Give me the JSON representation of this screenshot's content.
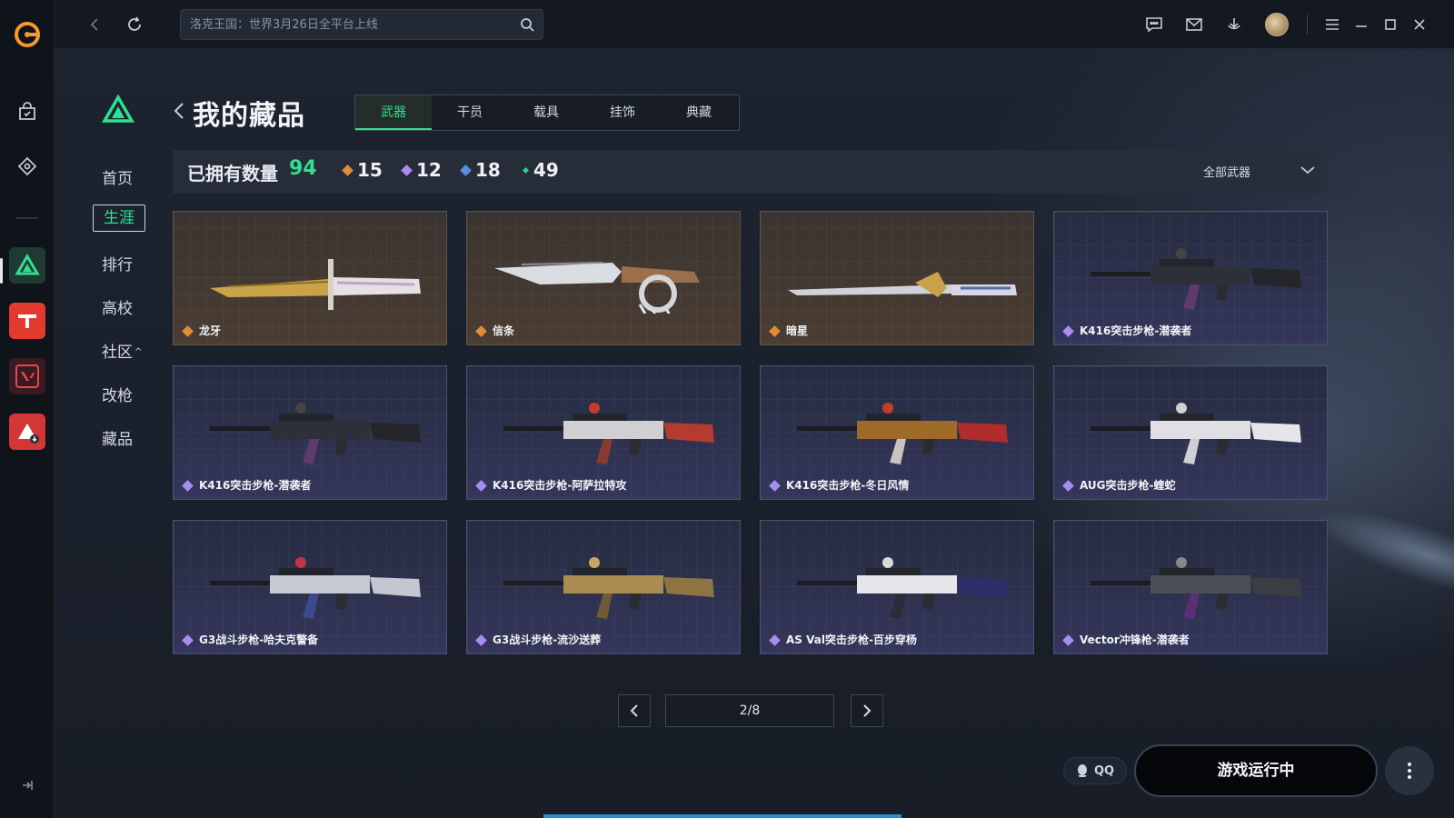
{
  "topbar": {
    "search_placeholder": "洛克王国：世界3月26日全平台上线"
  },
  "subnav": {
    "items": [
      {
        "label": "首页"
      },
      {
        "label": "生涯",
        "active": true
      },
      {
        "label": "排行"
      },
      {
        "label": "高校"
      },
      {
        "label": "社区"
      },
      {
        "label": "改枪"
      },
      {
        "label": "藏品"
      }
    ]
  },
  "header": {
    "title": "我的藏品",
    "tabs": [
      {
        "label": "武器",
        "active": true
      },
      {
        "label": "干员"
      },
      {
        "label": "载具"
      },
      {
        "label": "挂饰"
      },
      {
        "label": "典藏"
      }
    ]
  },
  "stats": {
    "owned_label": "已拥有数量",
    "owned_count": "94",
    "tiers": [
      {
        "value": "15",
        "color": "#e28a3a"
      },
      {
        "value": "12",
        "color": "#a98cf0"
      },
      {
        "value": "18",
        "color": "#5a8fe0"
      },
      {
        "value": "49",
        "color": "#2ecf8a"
      }
    ],
    "filter_label": "全部武器"
  },
  "colors": {
    "accent": "#2ee08f",
    "rarity_gold": "#e28a3a",
    "rarity_purple": "#a98cf0"
  },
  "items": [
    {
      "name": "龙牙",
      "rarity": "gold",
      "icon": "knife-icon"
    },
    {
      "name": "信条",
      "rarity": "gold",
      "icon": "knife-icon"
    },
    {
      "name": "暗星",
      "rarity": "gold",
      "icon": "knife-icon"
    },
    {
      "name": "K416突击步枪-潜袭者",
      "rarity": "purple",
      "icon": "rifle-icon"
    },
    {
      "name": "K416突击步枪-潜袭者",
      "rarity": "purple",
      "icon": "rifle-icon"
    },
    {
      "name": "K416突击步枪-阿萨拉特攻",
      "rarity": "purple",
      "icon": "rifle-icon"
    },
    {
      "name": "K416突击步枪-冬日风情",
      "rarity": "purple",
      "icon": "rifle-icon"
    },
    {
      "name": "AUG突击步枪-蝰蛇",
      "rarity": "purple",
      "icon": "rifle-icon"
    },
    {
      "name": "G3战斗步枪-哈夫克警备",
      "rarity": "purple",
      "icon": "rifle-icon"
    },
    {
      "name": "G3战斗步枪-流沙送葬",
      "rarity": "purple",
      "icon": "rifle-icon"
    },
    {
      "name": "AS Val突击步枪-百步穿杨",
      "rarity": "purple",
      "icon": "rifle-icon"
    },
    {
      "name": "Vector冲锋枪-潜袭者",
      "rarity": "purple",
      "icon": "smg-icon"
    }
  ],
  "pagination": {
    "label": "2/8",
    "current": 2,
    "total": 8
  },
  "footer": {
    "qq_label": "QQ",
    "launch_label": "游戏运行中"
  }
}
